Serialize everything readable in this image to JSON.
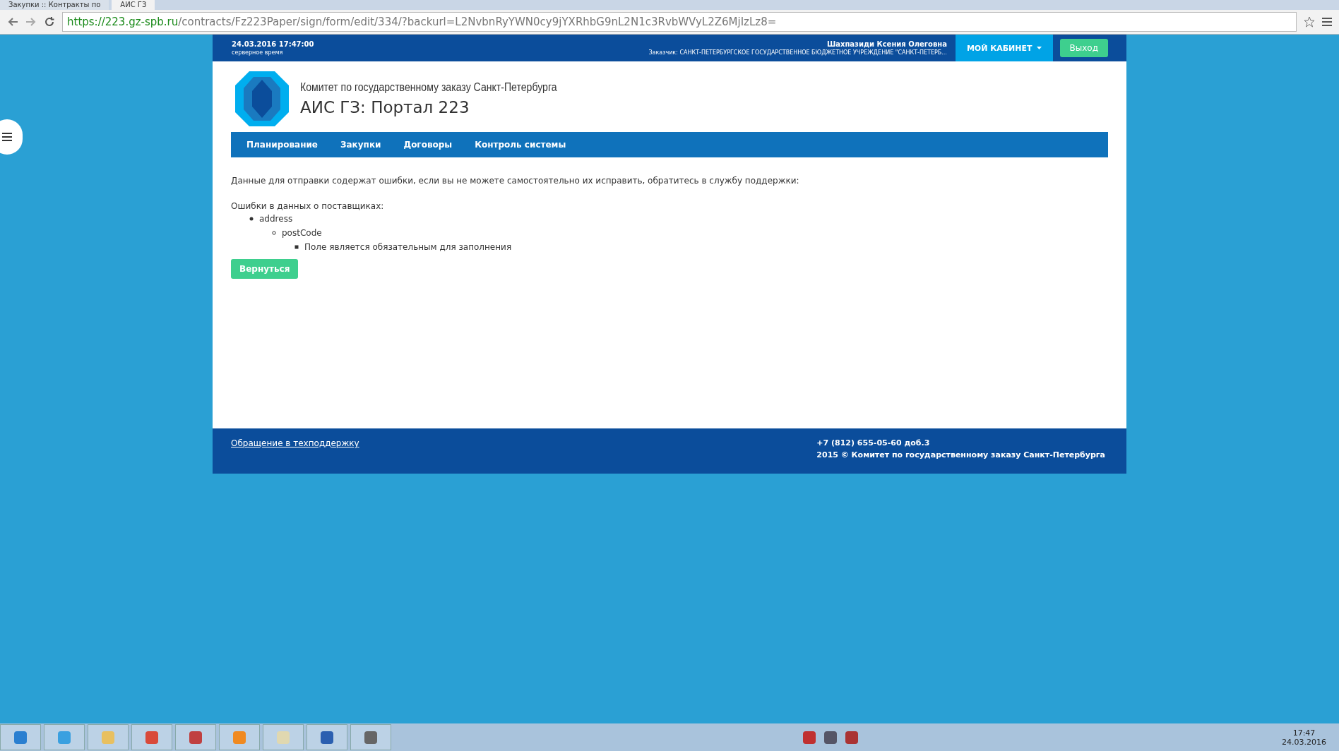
{
  "browser": {
    "tabs": [
      {
        "title": "Закупки :: Контракты по",
        "selected": false
      },
      {
        "title": "АИС ГЗ",
        "selected": true
      }
    ],
    "url_host": "https://223.gz-spb.ru",
    "url_path": "/contracts/Fz223Paper/sign/form/edit/334/?backurl=L2NvbnRyYWN0cy9jYXRhbG9nL2N1c3RvbWVyL2Z6MjIzLz8="
  },
  "header": {
    "datetime": "24.03.2016 17:47:00",
    "datetime_note": "серверное время",
    "user_name": "Шахпазиди Ксения Олеговна",
    "customer": "Заказчик: САНКТ-ПЕТЕРБУРГСКОЕ ГОСУДАРСТВЕННОЕ БЮДЖЕТНОЕ УЧРЕЖДЕНИЕ \"САНКТ-ПЕТЕРБ...",
    "cabinet_button": "МОЙ КАБИНЕТ",
    "logout_button": "Выход"
  },
  "brand": {
    "org": "Комитет по государственному заказу Санкт-Петербурга",
    "title": "АИС ГЗ: Портал 223"
  },
  "nav": [
    {
      "label": "Планирование"
    },
    {
      "label": "Закупки"
    },
    {
      "label": "Договоры"
    },
    {
      "label": "Контроль системы"
    }
  ],
  "content": {
    "message": "Данные для отправки содержат ошибки, если вы не можете самостоятельно их исправить, обратитесь в службу поддержки:",
    "errors_title": "Ошибки в данных о поставщиках:",
    "errors": [
      {
        "text": "address",
        "children": [
          {
            "text": "postCode",
            "children": [
              {
                "text": "Поле является обязательным для заполнения"
              }
            ]
          }
        ]
      }
    ],
    "back_button": "Вернуться"
  },
  "footer": {
    "support_link": "Обращение в техподдержку",
    "phone": "+7 (812) 655-05-60 доб.3",
    "copyright": "2015 © Комитет по государственному заказу Санкт-Петербурга"
  },
  "taskbar": {
    "time": "17:47",
    "date": "24.03.2016"
  }
}
